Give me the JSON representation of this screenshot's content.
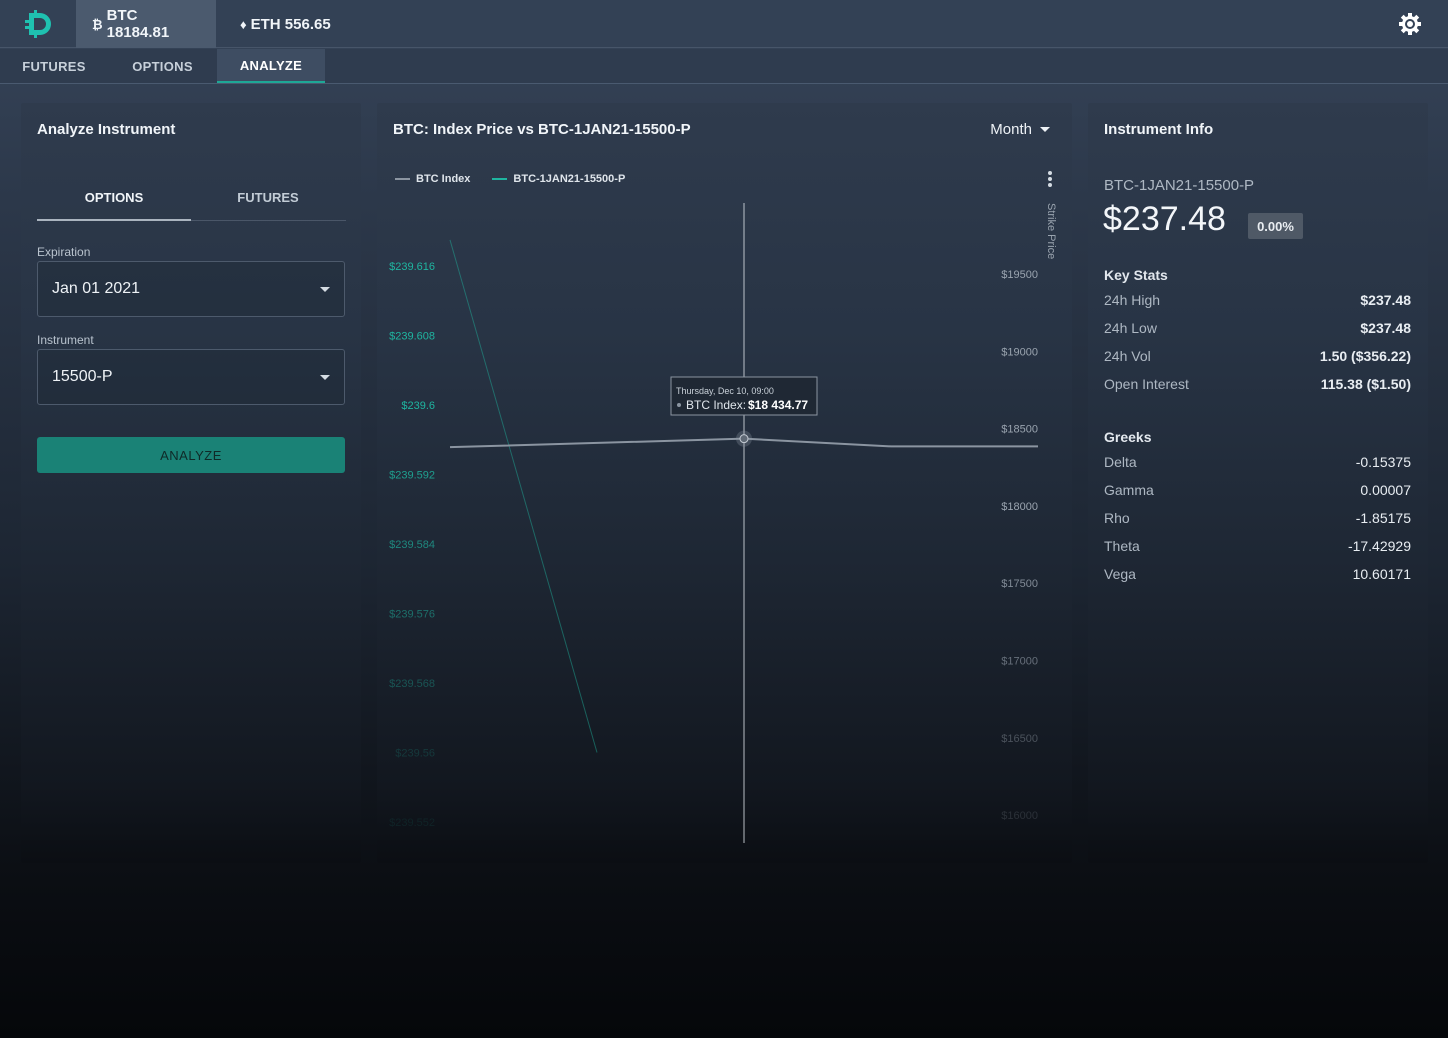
{
  "topbar": {
    "tickers": [
      {
        "symbol": "₿",
        "label": "BTC 18184.81"
      },
      {
        "symbol": "♦",
        "label": "ETH 556.65"
      }
    ],
    "accent": "#1fc1b0"
  },
  "nav": {
    "tabs": [
      "FUTURES",
      "OPTIONS",
      "ANALYZE"
    ],
    "active": "ANALYZE"
  },
  "analyze_panel": {
    "title": "Analyze Instrument",
    "subtabs": [
      "OPTIONS",
      "FUTURES"
    ],
    "active_subtab": "OPTIONS",
    "expiration_label": "Expiration",
    "expiration_value": "Jan 01 2021",
    "instrument_label": "Instrument",
    "instrument_value": "15500-P",
    "analyze_button": "ANALYZE"
  },
  "chart_panel": {
    "title": "BTC: Index Price vs BTC-1JAN21-15500-P",
    "range": "Month",
    "legend": [
      {
        "name": "BTC Index",
        "color": "#8b95a1"
      },
      {
        "name": "BTC-1JAN21-15500-P",
        "color": "#1fb5a0"
      }
    ],
    "right_axis_title": "Strike Price",
    "tooltip": {
      "date": "Thursday, Dec 10, 09:00",
      "series": "BTC Index:",
      "value": "$18 434.77"
    }
  },
  "chart_data": {
    "type": "line",
    "left_axis": {
      "ticks": [
        "$239.616",
        "$239.608",
        "$239.6",
        "$239.592",
        "$239.584",
        "$239.576",
        "$239.568",
        "$239.56",
        "$239.552"
      ],
      "color": "#1fb5a0"
    },
    "right_axis": {
      "title": "Strike Price",
      "ticks": [
        "$19500",
        "$19000",
        "$18500",
        "$18000",
        "$17500",
        "$17000",
        "$16500",
        "$16000"
      ],
      "ylim": [
        16000,
        19500
      ]
    },
    "series": [
      {
        "name": "BTC Index",
        "x_frac": [
          0.0,
          0.5,
          0.75,
          1.0
        ],
        "values": [
          18380,
          18434.77,
          18385,
          18385
        ]
      },
      {
        "name": "BTC-1JAN21-15500-P",
        "x_frac": [
          0.0,
          0.25
        ],
        "values": [
          239.619,
          239.56
        ]
      }
    ],
    "crosshair_x_frac": 0.5
  },
  "info_panel": {
    "title": "Instrument Info",
    "instrument": "BTC-1JAN21-15500-P",
    "price": "$237.48",
    "change": "0.00%",
    "key_stats_title": "Key Stats",
    "key_stats": [
      {
        "label": "24h High",
        "value": "$237.48"
      },
      {
        "label": "24h Low",
        "value": "$237.48"
      },
      {
        "label": "24h Vol",
        "value": "1.50 ($356.22)"
      },
      {
        "label": "Open Interest",
        "value": "115.38 ($1.50)"
      }
    ],
    "greeks_title": "Greeks",
    "greeks": [
      {
        "label": "Delta",
        "value": "-0.15375"
      },
      {
        "label": "Gamma",
        "value": "0.00007"
      },
      {
        "label": "Rho",
        "value": "-1.85175"
      },
      {
        "label": "Theta",
        "value": "-17.42929"
      },
      {
        "label": "Vega",
        "value": "10.60171"
      }
    ]
  }
}
